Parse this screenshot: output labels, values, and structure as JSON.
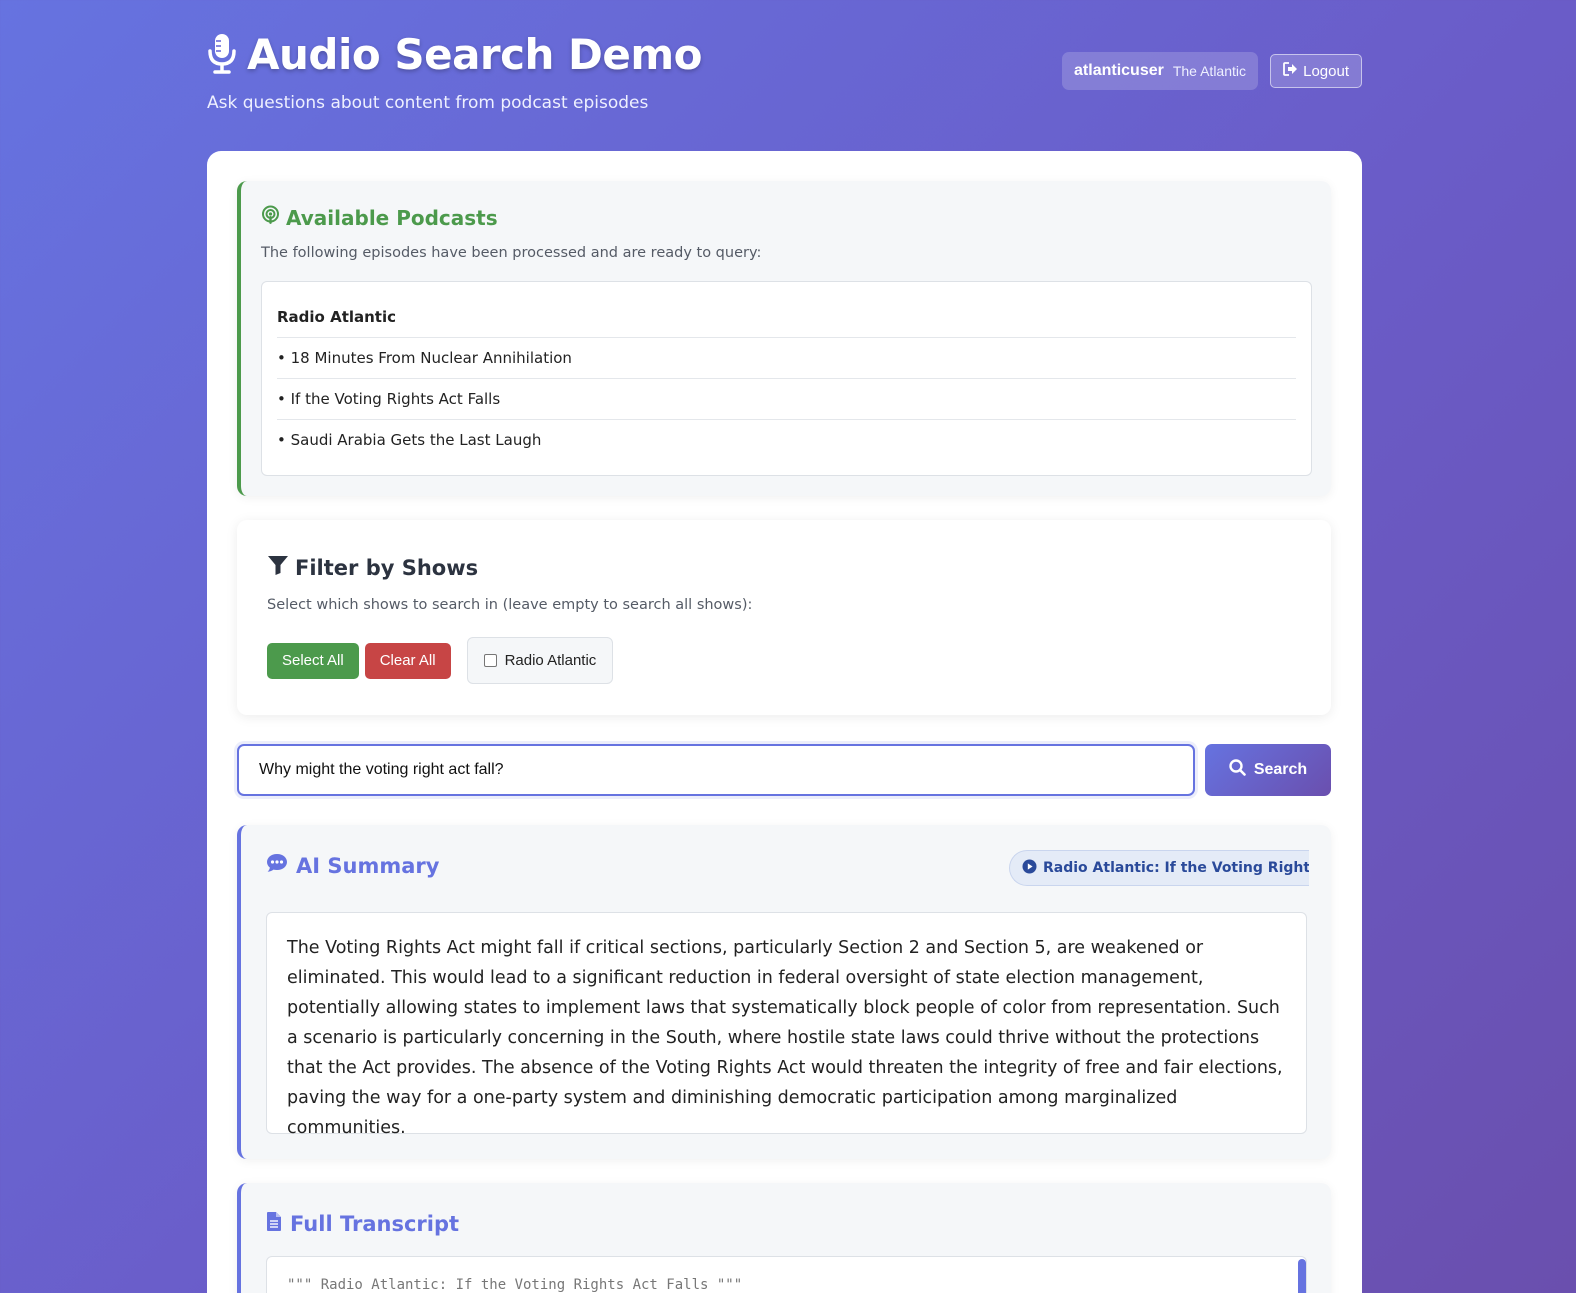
{
  "header": {
    "title": "Audio Search Demo",
    "subtitle": "Ask questions about content from podcast episodes",
    "user_name": "atlanticuser",
    "user_org": "The Atlantic",
    "logout_label": "Logout"
  },
  "podcasts": {
    "heading": "Available Podcasts",
    "description": "The following episodes have been processed and are ready to query:",
    "show": "Radio Atlantic",
    "episodes": [
      "• 18 Minutes From Nuclear Annihilation",
      "• If the Voting Rights Act Falls",
      "• Saudi Arabia Gets the Last Laugh"
    ]
  },
  "filter": {
    "heading": "Filter by Shows",
    "description": "Select which shows to search in (leave empty to search all shows):",
    "select_all_label": "Select All",
    "clear_all_label": "Clear All",
    "show_option": "Radio Atlantic"
  },
  "search": {
    "value": "Why might the voting right act fall?",
    "button_label": "Search"
  },
  "summary": {
    "heading": "AI Summary",
    "source": "Radio Atlantic: If the Voting Rights Act",
    "text": "The Voting Rights Act might fall if critical sections, particularly Section 2 and Section 5, are weakened or eliminated. This would lead to a significant reduction in federal oversight of state election management, potentially allowing states to implement laws that systematically block people of color from representation. Such a scenario is particularly concerning in the South, where hostile state laws could thrive without the protections that the Act provides. The absence of the Voting Rights Act would threaten the integrity of free and fair elections, paving the way for a one-party system and diminishing democratic participation among marginalized communities."
  },
  "transcript": {
    "heading": "Full Transcript",
    "first_line": "\"\"\" Radio Atlantic: If the Voting Rights Act Falls \"\"\""
  },
  "colors": {
    "accent": "#6673e0",
    "success": "#4c9a4c",
    "danger": "#c74545"
  },
  "icons": [
    "microphone-icon",
    "logout-icon",
    "podcast-icon",
    "filter-icon",
    "search-icon",
    "comment-dots-icon",
    "play-circle-icon",
    "file-text-icon"
  ]
}
